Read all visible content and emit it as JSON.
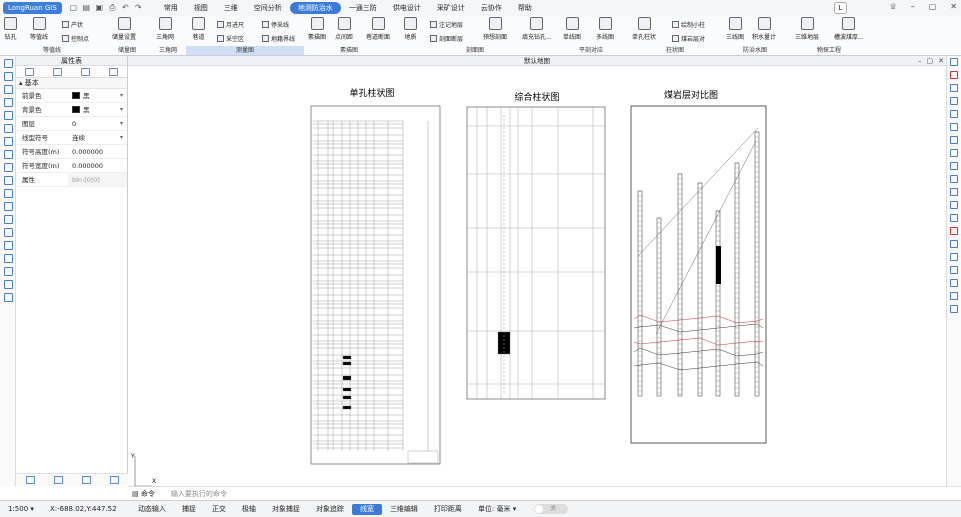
{
  "app": {
    "name": "LongRuan GIS"
  },
  "menu": [
    "常用",
    "视图",
    "三维",
    "空间分析",
    "地测防治水",
    "一通三防",
    "供电设计",
    "采矿设计",
    "云协作",
    "帮助"
  ],
  "menu_active": "地测防治水",
  "user_badge": "L",
  "ribbon": {
    "buttons": [
      "钻孔",
      "等值线",
      "储量设置",
      "三角网",
      "巷道",
      "素描图",
      "点间距",
      "巷道断面",
      "地质",
      "预想剖面",
      "填充钻孔...",
      "单线图",
      "多线图",
      "单孔柱状",
      "三线图",
      "积水量计",
      "三维地层",
      "槽波煤厚..."
    ],
    "small": [
      "产状",
      "控制点",
      "月进尺",
      "停采线",
      "采空区",
      "地籍界线",
      "注记地层",
      "剖面断层",
      "绘制小柱",
      "煤岩层对"
    ],
    "groups": [
      "等值线",
      "储量图",
      "三角网",
      "测量图",
      "素描图",
      "剖面图",
      "平剖对应",
      "柱状图",
      "防治水图",
      "物探工程"
    ]
  },
  "panel": {
    "title": "属性表",
    "section": "基本",
    "rows": [
      {
        "key": "前景色",
        "value": "黑"
      },
      {
        "key": "背景色",
        "value": "黑"
      },
      {
        "key": "图层",
        "value": "0"
      },
      {
        "key": "线型符号",
        "value": "连续"
      },
      {
        "key": "符号高度(m)",
        "value": "0.000000"
      },
      {
        "key": "符号宽度(m)",
        "value": "0.000000"
      },
      {
        "key": "属性",
        "value": "bln:[0|0]"
      }
    ]
  },
  "canvas": {
    "title": "默认地图",
    "drawings": [
      "单孔柱状图",
      "综合柱状图",
      "煤岩层对比图"
    ],
    "axis_x": "X",
    "axis_y": "Y"
  },
  "command": {
    "label": "命令",
    "placeholder": "输入要执行的命令"
  },
  "status": {
    "scale": "1:500",
    "coords": "X:-688.02,Y:447.52",
    "toggles": [
      "动态输入",
      "捕捉",
      "正交",
      "极轴",
      "对象捕捉",
      "对象追踪",
      "线宽",
      "三维编辑",
      "打印距离"
    ],
    "active_toggle": "线宽",
    "unit_label": "单位:",
    "unit": "毫米",
    "switch": "关"
  }
}
